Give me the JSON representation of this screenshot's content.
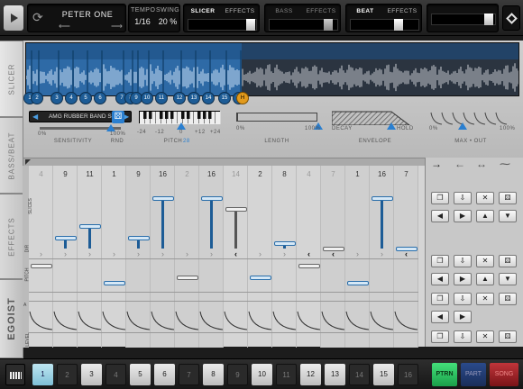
{
  "topbar": {
    "preset_name": "PETER ONE",
    "tempo_label": "TEMPO",
    "tempo_value": "1/16",
    "swing_label": "SWING",
    "swing_value": "20 %",
    "tabs": [
      {
        "left": "SLICER",
        "right": "EFFECTS"
      },
      {
        "left": "BASS",
        "right": "EFFECTS"
      },
      {
        "left": "BEAT",
        "right": "EFFECTS"
      }
    ]
  },
  "side_tabs": [
    "SLICER",
    "BASS/BEAT",
    "EFFECTS",
    "EGOIST"
  ],
  "slicer": {
    "slice_markers": [
      "1",
      "2",
      "3",
      "4",
      "5",
      "6",
      "7",
      "8",
      "9",
      "10",
      "11",
      "12",
      "13",
      "14",
      "15",
      "16",
      "H"
    ],
    "stretch_mode": "AMG RUBBER BAND SE",
    "pitch_labels": [
      "-24",
      "-12",
      "0",
      "+12",
      "+24"
    ],
    "pitch_value": "28",
    "length_labels": [
      "0%",
      "100%"
    ],
    "decay_label": "DECAY",
    "hold_label": "HOLD",
    "maxout_labels": [
      "0%",
      "100%"
    ],
    "param_labels": {
      "sensitivity": "SENSITIVITY",
      "rnd": "RND",
      "pitch": "PITCH",
      "length": "LENGTH",
      "envelope": "ENVELOPE",
      "maxout": "MAX • OUT"
    },
    "sens_labels": [
      "0%",
      "100%"
    ]
  },
  "sequencer": {
    "steps": [
      "4",
      "9",
      "11",
      "1",
      "9",
      "16",
      "2",
      "16",
      "14",
      "2",
      "8",
      "4",
      "7",
      "1",
      "16",
      "7"
    ],
    "active": [
      false,
      true,
      true,
      true,
      true,
      true,
      false,
      true,
      false,
      true,
      true,
      false,
      false,
      true,
      true,
      true
    ],
    "row_labels": [
      "SLICES",
      "DIR",
      "PITCH",
      "A",
      "LEVEL"
    ]
  },
  "transport": {
    "steps": [
      "1",
      "2",
      "3",
      "4",
      "5",
      "6",
      "7",
      "8",
      "9",
      "10",
      "11",
      "12",
      "13",
      "14",
      "15",
      "16"
    ],
    "lit": [
      true,
      false,
      true,
      false,
      true,
      true,
      false,
      true,
      false,
      true,
      false,
      true,
      true,
      false,
      true,
      false
    ],
    "modes": [
      "PTRN",
      "PART",
      "SONG"
    ]
  }
}
